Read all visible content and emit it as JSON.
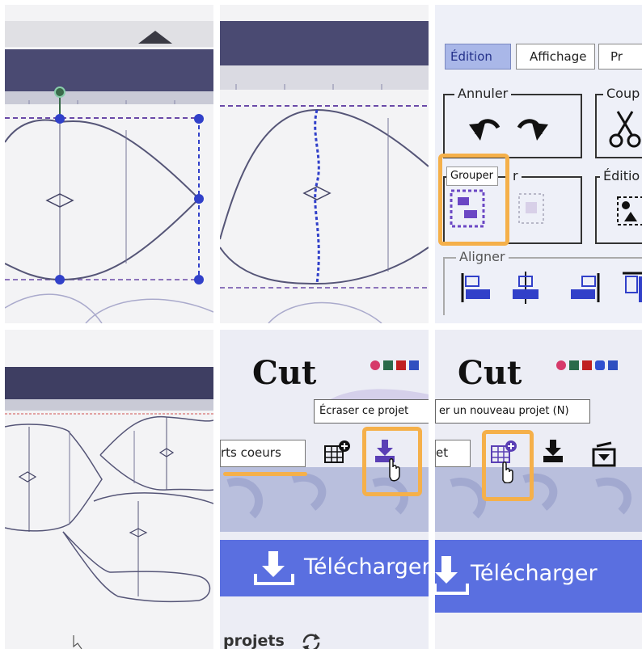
{
  "ribbon": {
    "tabs": [
      {
        "label": "Édition",
        "active": true
      },
      {
        "label": "Affichage",
        "active": false
      },
      {
        "label": "Pr",
        "active": false
      }
    ],
    "groups": {
      "undo": {
        "label": "Annuler"
      },
      "cut": {
        "label": "Coup"
      },
      "group": {
        "label": "r",
        "tooltip": "Grouper"
      },
      "edit": {
        "label": "Éditio"
      },
      "align": {
        "label": "Aligner"
      }
    }
  },
  "project": {
    "name_value": "rts coeurs",
    "name_value_partial": "et",
    "overwrite_tooltip": "Écraser ce projet",
    "new_tooltip": "er un nouveau projet (N)",
    "download_label": "Télécharger",
    "projects_label": "projets",
    "logo_text": "Cut"
  },
  "colors": {
    "highlight": "#f5b04a",
    "accent_blue": "#5a6fe0",
    "nav_dark": "#3d3d66",
    "selection_blue": "#3140c9",
    "group_purple": "#6b47c4"
  },
  "icons": [
    "undo-arrow-icon",
    "redo-arrow-icon",
    "scissors-icon",
    "group-icon",
    "ungroup-icon",
    "edit-shape-icon",
    "align-icon",
    "new-project-icon",
    "overwrite-save-icon",
    "save-tray-icon",
    "download-icon",
    "refresh-icon",
    "hand-cursor-icon"
  ]
}
